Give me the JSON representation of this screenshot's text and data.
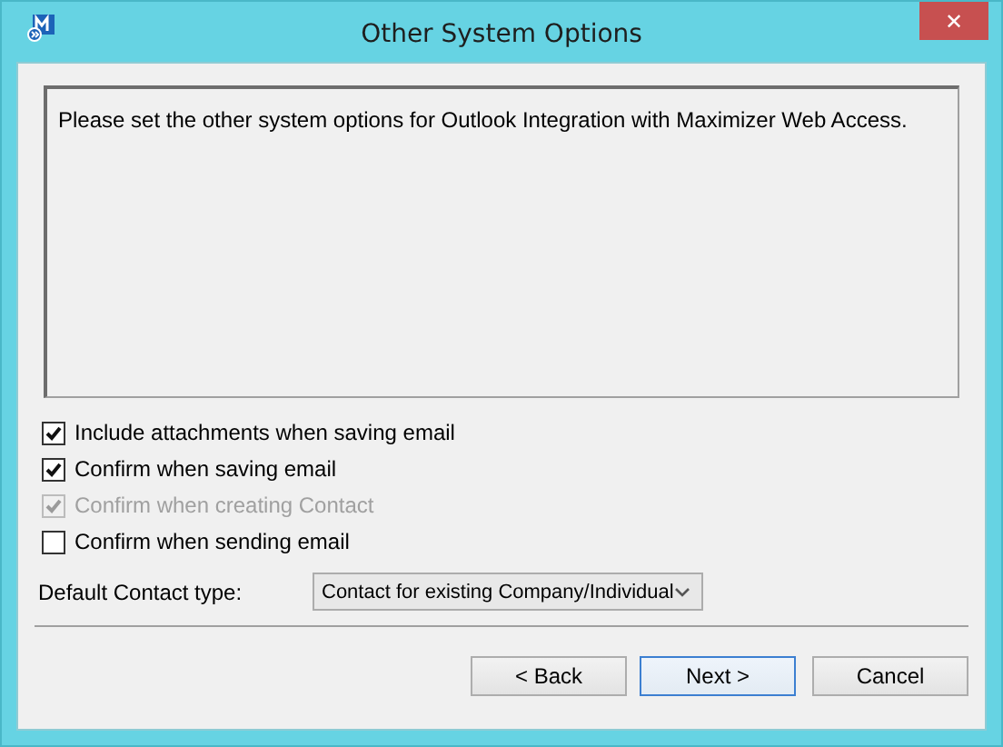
{
  "window": {
    "title": "Other System Options",
    "close": "✕"
  },
  "message": "Please set the other system options for Outlook Integration with Maximizer Web Access.",
  "options": [
    {
      "label": "Include attachments when saving email",
      "checked": true,
      "disabled": false
    },
    {
      "label": "Confirm when saving email",
      "checked": true,
      "disabled": false
    },
    {
      "label": "Confirm when creating Contact",
      "checked": true,
      "disabled": true
    },
    {
      "label": "Confirm when sending email",
      "checked": false,
      "disabled": false
    }
  ],
  "contact_type": {
    "label": "Default Contact type:",
    "value": "Contact for existing Company/Individual"
  },
  "buttons": [
    {
      "label": "< Back",
      "default": false
    },
    {
      "label": "Next >",
      "default": true
    },
    {
      "label": "Cancel",
      "default": false
    }
  ]
}
